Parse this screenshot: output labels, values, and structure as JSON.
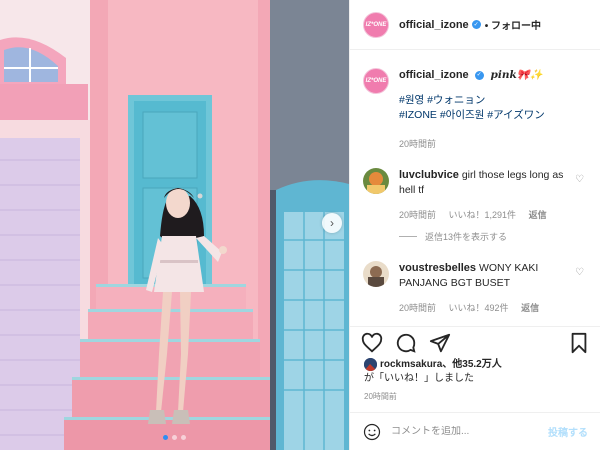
{
  "account": {
    "username": "official_izone",
    "avatar_text": "IZ*ONE",
    "follow_status": "• フォロー中"
  },
  "caption": {
    "username": "official_izone",
    "text": "pink🎀✨",
    "hashtags_line1": "#원영 #ウォニョン",
    "hashtags_line2": "#IZONE #아이즈원 #アイズワン",
    "time": "20時間前"
  },
  "comments": [
    {
      "username": "luvclubvice",
      "text": "girl those legs long as hell tf",
      "time": "20時間前",
      "likes": "いいね！1,291件",
      "reply": "返信",
      "view_replies": "返信13件を表示する"
    },
    {
      "username": "voustresbelles",
      "text": "WONY KAKI PANJANG BGT BUSET",
      "time": "20時間前",
      "likes": "いいね！492件",
      "reply": "返信"
    }
  ],
  "liked_by": {
    "username": "rockmsakura",
    "others": "、他35.2万人",
    "suffix": "が「いいね！」しました"
  },
  "post_time": "20時間前",
  "comment_box": {
    "placeholder": "コメントを追加...",
    "post_label": "投稿する"
  },
  "icons": {
    "like": "heart-icon",
    "comment": "comment-icon",
    "share": "send-icon",
    "save": "bookmark-icon",
    "emoji": "smiley-icon",
    "next": "chevron-right-icon",
    "verified": "verified-badge-icon"
  },
  "carousel": {
    "current": 1,
    "total": 3
  },
  "colors": {
    "verified": "#3897f0",
    "link": "#00376b",
    "post_button": "#b2dffc",
    "carousel_active": "#2f8ef3"
  }
}
